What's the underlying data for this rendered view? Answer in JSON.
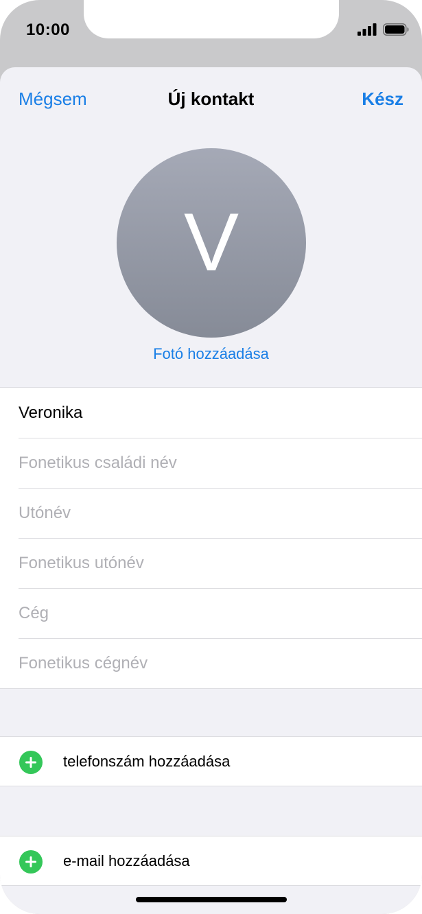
{
  "status_bar": {
    "time": "10:00",
    "icons": [
      "signal-icon",
      "battery-icon"
    ]
  },
  "nav": {
    "cancel_label": "Mégsem",
    "title": "Új kontakt",
    "done_label": "Kész"
  },
  "avatar": {
    "initial": "V",
    "add_photo_label": "Fotó hozzáadása"
  },
  "name_fields": [
    {
      "value": "Veronika",
      "placeholder": ""
    },
    {
      "value": "",
      "placeholder": "Fonetikus családi név"
    },
    {
      "value": "",
      "placeholder": "Utónév"
    },
    {
      "value": "",
      "placeholder": "Fonetikus utónév"
    },
    {
      "value": "",
      "placeholder": "Cég"
    },
    {
      "value": "",
      "placeholder": "Fonetikus cégnév"
    }
  ],
  "actions": {
    "add_phone_label": "telefonszám hozzáadása",
    "add_email_label": "e-mail hozzáadása"
  },
  "colors": {
    "accent": "#1a7fe6",
    "add_green": "#34c759",
    "avatar_top": "#a5a9b6",
    "avatar_bottom": "#868b97",
    "placeholder": "#b0b0b5",
    "sheet_bg": "#f1f1f6"
  }
}
